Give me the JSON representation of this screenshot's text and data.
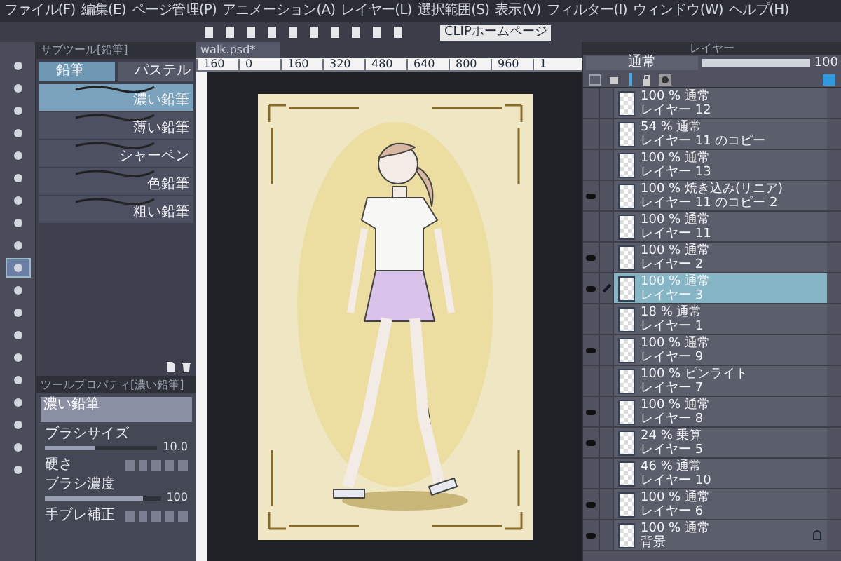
{
  "menu": [
    "ファイル(F)",
    "編集(E)",
    "ページ管理(P)",
    "アニメーション(A)",
    "レイヤー(L)",
    "選択範囲(S)",
    "表示(V)",
    "フィルター(I)",
    "ウィンドウ(W)",
    "ヘルプ(H)"
  ],
  "toolbar": {
    "home_button": "CLIPホームページ"
  },
  "tools": [
    {
      "selected": false
    },
    {
      "selected": false
    },
    {
      "selected": false
    },
    {
      "selected": false
    },
    {
      "selected": false
    },
    {
      "selected": false
    },
    {
      "selected": false
    },
    {
      "selected": false
    },
    {
      "selected": false
    },
    {
      "selected": true
    },
    {
      "selected": false
    },
    {
      "selected": false
    },
    {
      "selected": false
    },
    {
      "selected": false
    },
    {
      "selected": false
    },
    {
      "selected": false
    },
    {
      "selected": false
    },
    {
      "selected": false
    },
    {
      "selected": false
    }
  ],
  "subtool_panel": {
    "title": "サブツール[鉛筆]",
    "tabs": [
      {
        "label": "鉛筆",
        "selected": true
      },
      {
        "label": "パステル",
        "selected": false
      }
    ],
    "brushes": [
      {
        "name": "濃い鉛筆",
        "selected": true
      },
      {
        "name": "薄い鉛筆",
        "selected": false
      },
      {
        "name": "シャーペン",
        "selected": false
      },
      {
        "name": "色鉛筆",
        "selected": false
      },
      {
        "name": "粗い鉛筆",
        "selected": false
      }
    ]
  },
  "tool_property": {
    "title": "ツールプロパティ[濃い鉛筆]",
    "preview_label": "濃い鉛筆",
    "brush_size": {
      "label": "ブラシサイズ",
      "value": "10.0",
      "level": 0.45
    },
    "hardness": {
      "label": "硬さ"
    },
    "density": {
      "label": "ブラシ濃度",
      "value": "100",
      "level": 0.85
    },
    "stabilization": {
      "label": "手ブレ補正"
    }
  },
  "document": {
    "tab": "walk.psd*",
    "ruler": [
      "160",
      "0",
      "160",
      "320",
      "480",
      "640",
      "800",
      "960",
      "1"
    ]
  },
  "layer_panel": {
    "title": "レイヤー",
    "blend_mode": "通常",
    "opacity": {
      "value": "100",
      "level": 1
    },
    "layers": [
      {
        "mode": "100 % 通常",
        "name": "レイヤー 12",
        "visible": false,
        "selected": false,
        "locked": false
      },
      {
        "mode": "54 % 通常",
        "name": "レイヤー 11 のコピー",
        "visible": false,
        "selected": false,
        "locked": false
      },
      {
        "mode": "100 % 通常",
        "name": "レイヤー 13",
        "visible": false,
        "selected": false,
        "locked": false
      },
      {
        "mode": "100 % 焼き込み(リニア)",
        "name": "レイヤー 11 のコピー 2",
        "visible": true,
        "selected": false,
        "locked": false
      },
      {
        "mode": "100 % 通常",
        "name": "レイヤー 11",
        "visible": false,
        "selected": false,
        "locked": false
      },
      {
        "mode": "100 % 通常",
        "name": "レイヤー 2",
        "visible": true,
        "selected": false,
        "locked": false
      },
      {
        "mode": "100 % 通常",
        "name": "レイヤー 3",
        "visible": true,
        "selected": true,
        "locked": false
      },
      {
        "mode": "18 % 通常",
        "name": "レイヤー 1",
        "visible": false,
        "selected": false,
        "locked": false
      },
      {
        "mode": "100 % 通常",
        "name": "レイヤー 9",
        "visible": true,
        "selected": false,
        "locked": false
      },
      {
        "mode": "100 % ピンライト",
        "name": "レイヤー 7",
        "visible": false,
        "selected": false,
        "locked": false
      },
      {
        "mode": "100 % 通常",
        "name": "レイヤー 8",
        "visible": true,
        "selected": false,
        "locked": false
      },
      {
        "mode": "24 % 乗算",
        "name": "レイヤー 5",
        "visible": true,
        "selected": false,
        "locked": false
      },
      {
        "mode": "46 % 通常",
        "name": "レイヤー 10",
        "visible": false,
        "selected": false,
        "locked": false
      },
      {
        "mode": "100 % 通常",
        "name": "レイヤー 6",
        "visible": true,
        "selected": false,
        "locked": false
      },
      {
        "mode": "100 % 通常",
        "name": "背景",
        "visible": true,
        "selected": false,
        "locked": true
      }
    ]
  }
}
